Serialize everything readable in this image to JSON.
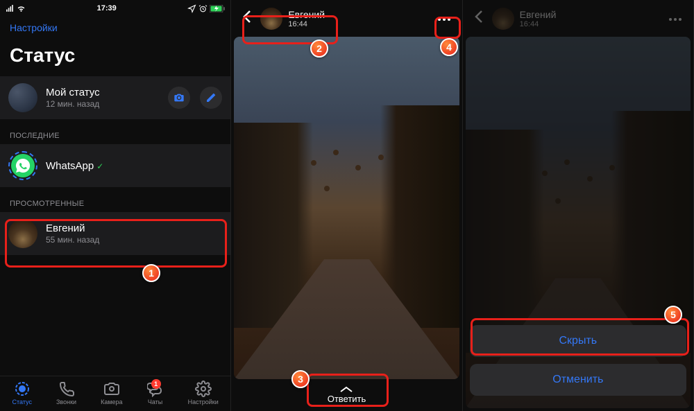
{
  "statusbar": {
    "time": "17:39"
  },
  "phone1": {
    "settings_link": "Настройки",
    "page_title": "Статус",
    "my_status": {
      "name": "Мой статус",
      "time": "12 мин. назад"
    },
    "section_recent": "ПОСЛЕДНИЕ",
    "whatsapp_row": {
      "name": "WhatsApp"
    },
    "section_viewed": "ПРОСМОТРЕННЫЕ",
    "evgeniy_row": {
      "name": "Евгений",
      "time": "55 мин. назад"
    },
    "tabs": {
      "status": "Статус",
      "calls": "Звонки",
      "camera": "Камера",
      "chats": "Чаты",
      "settings": "Настройки",
      "chats_badge": "1"
    }
  },
  "story": {
    "name": "Евгений",
    "time": "16:44",
    "reply": "Ответить"
  },
  "sheet": {
    "hide": "Скрыть",
    "cancel": "Отменить"
  },
  "markers": {
    "m1": "1",
    "m2": "2",
    "m3": "3",
    "m4": "4",
    "m5": "5"
  }
}
